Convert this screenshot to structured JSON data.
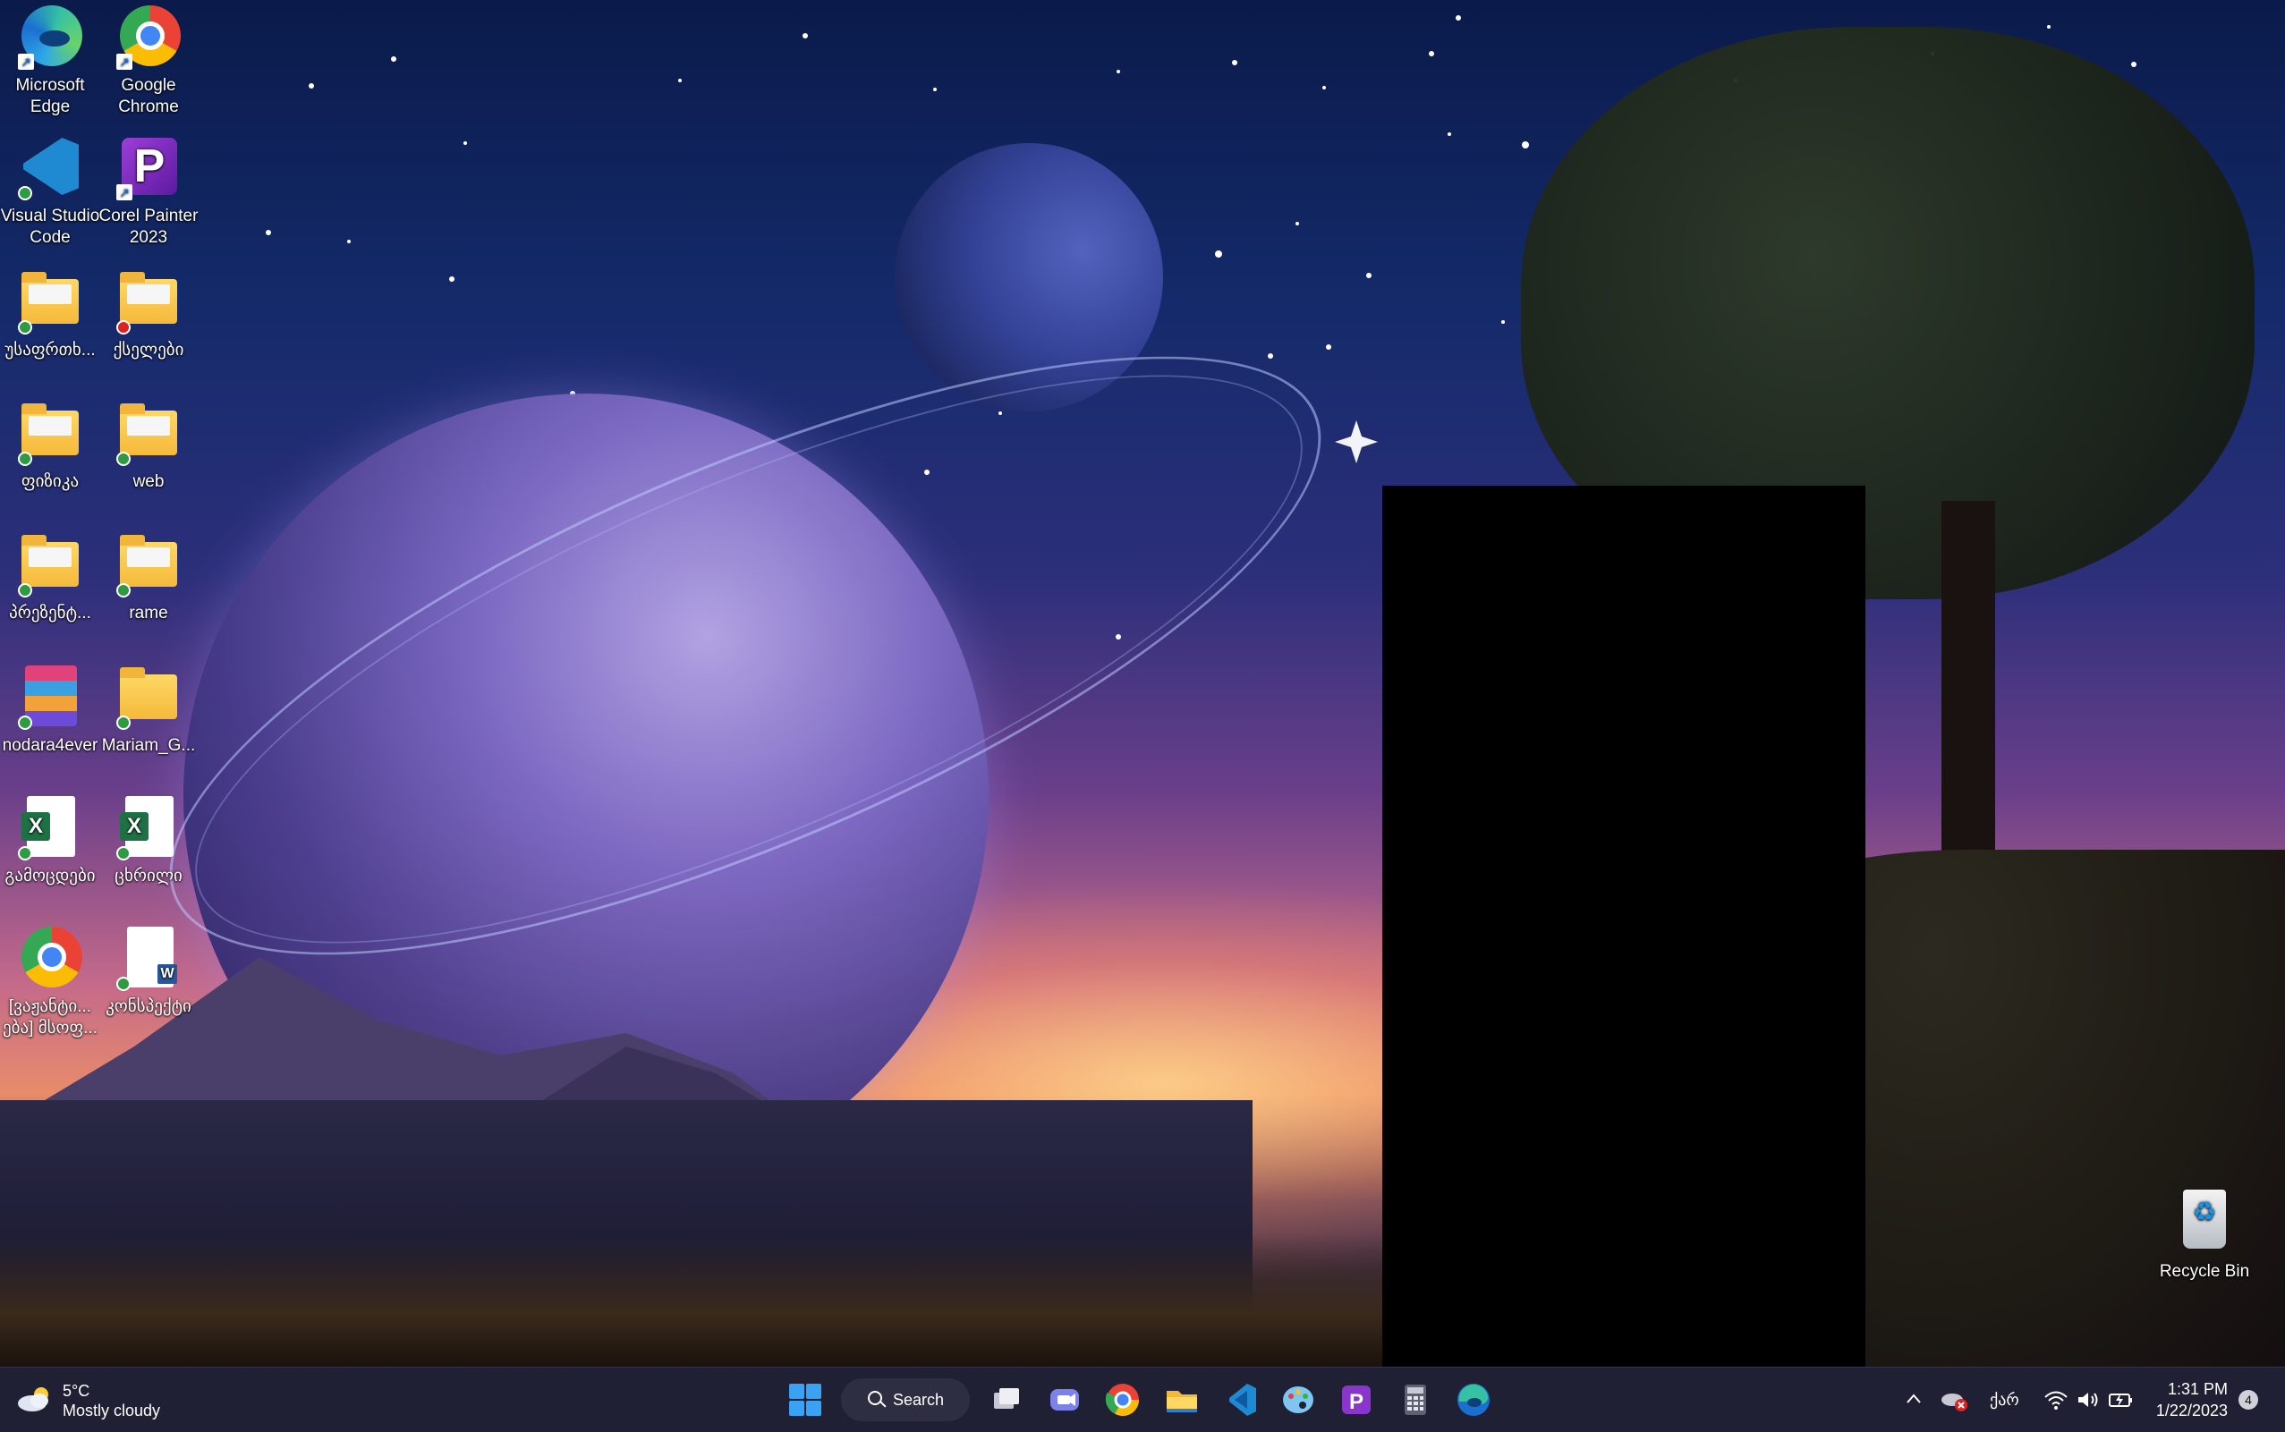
{
  "desktop": {
    "icons": [
      {
        "label": "Microsoft\nEdge",
        "type": "edge"
      },
      {
        "label": "Google\nChrome",
        "type": "chrome"
      },
      {
        "label": "Visual Studio\nCode",
        "type": "vscode"
      },
      {
        "label": "Corel Painter\n2023",
        "type": "painter"
      },
      {
        "label": "უსაფრთხ...",
        "type": "folder"
      },
      {
        "label": "ქსელები",
        "type": "folder"
      },
      {
        "label": "ფიზიკა",
        "type": "folder"
      },
      {
        "label": "web",
        "type": "folder"
      },
      {
        "label": "პრეზენტ...",
        "type": "folder"
      },
      {
        "label": "rame",
        "type": "folder"
      },
      {
        "label": "nodara4ever",
        "type": "archive"
      },
      {
        "label": "Mariam_G...",
        "type": "folder"
      },
      {
        "label": "გამოცდები",
        "type": "excel"
      },
      {
        "label": "ცხრილი",
        "type": "excel"
      },
      {
        "label": "[ვაჟანტი...\nება] მსოფ...",
        "type": "chrome"
      },
      {
        "label": "კონსპექტი",
        "type": "word"
      },
      {
        "label": "Recycle Bin",
        "type": "recycle-bin"
      }
    ],
    "excel_glyph": "X",
    "word_glyph": "W",
    "painter_glyph": "P",
    "shortcut_glyph": "↗"
  },
  "taskbar": {
    "weather": {
      "temp": "5°C",
      "condition": "Mostly cloudy"
    },
    "search_label": "Search",
    "pinned": [
      "task-view",
      "teams-chat",
      "chrome",
      "file-explorer",
      "vscode",
      "paint",
      "corel-painter",
      "calculator",
      "edge"
    ],
    "tray": {
      "chevron": "^",
      "language": "ქარ",
      "time": "1:31 PM",
      "date": "1/22/2023",
      "notification_count": "4"
    }
  },
  "colors": {
    "taskbar_bg": "#1f2033",
    "accent": "#3aa2f2"
  }
}
